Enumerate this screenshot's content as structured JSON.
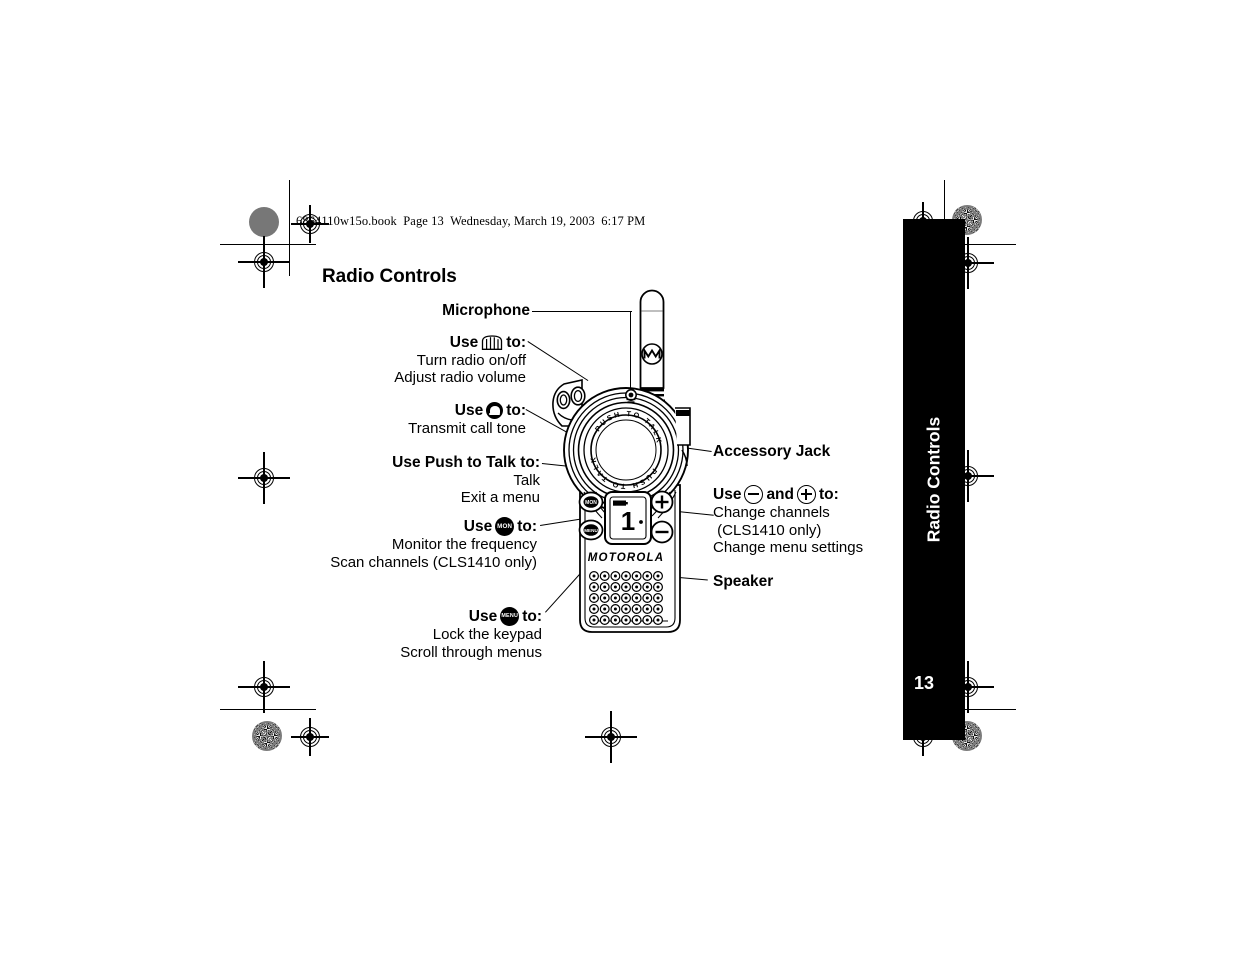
{
  "document": {
    "running_header": "6864110w15o.book  Page 13  Wednesday, March 19, 2003  6:17 PM",
    "page_title": "Radio Controls",
    "page_number": "13",
    "side_tab_title": "Radio Controls"
  },
  "callouts": {
    "microphone": {
      "heading": "Microphone"
    },
    "volume_knob": {
      "heading_pre": "Use",
      "heading_post": "to:",
      "icon": "volume-knob-icon",
      "lines": [
        "Turn radio on/off",
        "Adjust radio volume"
      ]
    },
    "call_tone": {
      "heading_pre": "Use",
      "heading_post": "to:",
      "icon": "call-bell-icon",
      "lines": [
        "Transmit call tone"
      ]
    },
    "push_to_talk": {
      "heading": "Use Push to Talk to:",
      "lines": [
        "Talk",
        "Exit a menu"
      ]
    },
    "monitor": {
      "heading_pre": "Use",
      "heading_post": "to:",
      "icon": "mon-button-icon",
      "icon_label": "MON",
      "lines": [
        "Monitor the frequency",
        "Scan channels (CLS1410 only)"
      ]
    },
    "menu": {
      "heading_pre": "Use",
      "heading_post": "to:",
      "icon": "menu-button-icon",
      "icon_label": "MENU",
      "lines": [
        "Lock the keypad",
        "Scroll through menus"
      ]
    },
    "accessory_jack": {
      "heading": "Accessory Jack"
    },
    "channel_buttons": {
      "heading_pre": "Use",
      "heading_mid": "and",
      "heading_post": "to:",
      "icon_minus": "minus-button-icon",
      "icon_plus": "plus-button-icon",
      "lines": [
        "Change channels",
        " (CLS1410 only)",
        "Change menu settings"
      ]
    },
    "speaker": {
      "heading": "Speaker"
    }
  },
  "radio": {
    "brand_text": "MOTOROLA",
    "ptt_ring_text": "PUSH TO TALK",
    "display_channel": "1",
    "button_mon": "MON",
    "button_menu": "MENU",
    "antenna_logo": "motorola-m-logo"
  },
  "colors": {
    "ink": "#000000",
    "paper": "#ffffff",
    "tab_background": "#000000",
    "tab_text": "#ffffff"
  }
}
